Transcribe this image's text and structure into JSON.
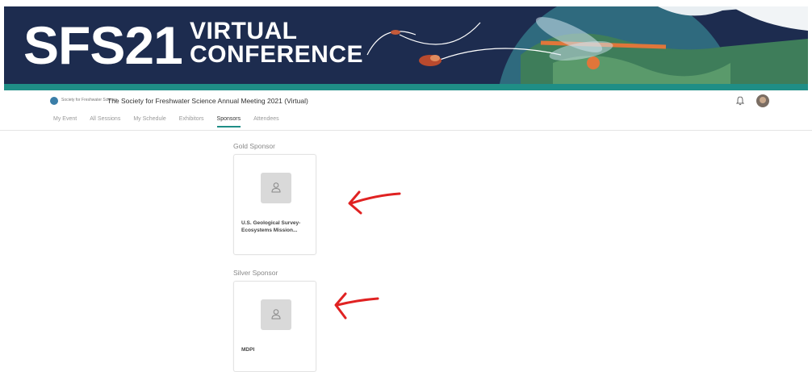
{
  "banner": {
    "title": "SFS21",
    "subtitle_line1": "VIRTUAL",
    "subtitle_line2": "CONFERENCE"
  },
  "header": {
    "org_name": "Society for Freshwater Science",
    "event_title": "The Society for Freshwater Science Annual Meeting 2021 (Virtual)"
  },
  "tabs": [
    {
      "label": "My Event"
    },
    {
      "label": "All Sessions"
    },
    {
      "label": "My Schedule"
    },
    {
      "label": "Exhibitors"
    },
    {
      "label": "Sponsors"
    },
    {
      "label": "Attendees"
    }
  ],
  "active_tab": "Sponsors",
  "sections": [
    {
      "label": "Gold Sponsor",
      "sponsor": "U.S. Geological Survey-Ecosystems Mission..."
    },
    {
      "label": "Silver Sponsor",
      "sponsor": "MDPI"
    }
  ],
  "colors": {
    "banner_bg": "#1d2c4f",
    "accent": "#1f8e86",
    "annotation": "#e02222"
  }
}
